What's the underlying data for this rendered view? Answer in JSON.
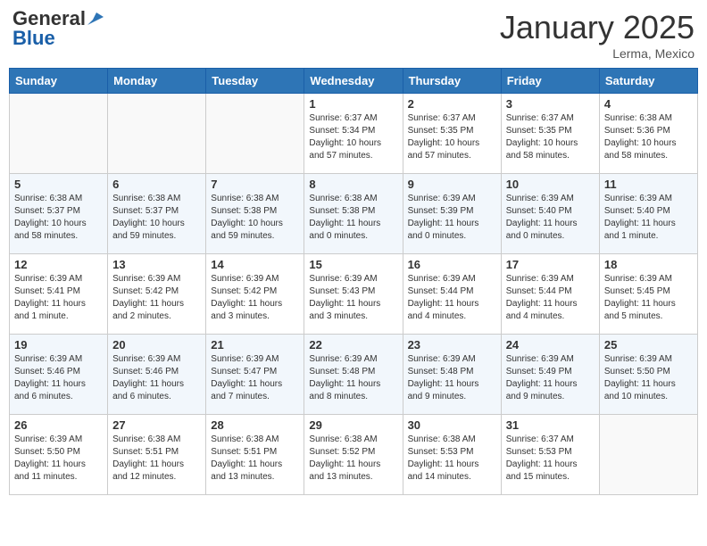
{
  "header": {
    "logo_general": "General",
    "logo_blue": "Blue",
    "month": "January 2025",
    "location": "Lerma, Mexico"
  },
  "days_of_week": [
    "Sunday",
    "Monday",
    "Tuesday",
    "Wednesday",
    "Thursday",
    "Friday",
    "Saturday"
  ],
  "weeks": [
    [
      {
        "day": "",
        "info": ""
      },
      {
        "day": "",
        "info": ""
      },
      {
        "day": "",
        "info": ""
      },
      {
        "day": "1",
        "info": "Sunrise: 6:37 AM\nSunset: 5:34 PM\nDaylight: 10 hours and 57 minutes."
      },
      {
        "day": "2",
        "info": "Sunrise: 6:37 AM\nSunset: 5:35 PM\nDaylight: 10 hours and 57 minutes."
      },
      {
        "day": "3",
        "info": "Sunrise: 6:37 AM\nSunset: 5:35 PM\nDaylight: 10 hours and 58 minutes."
      },
      {
        "day": "4",
        "info": "Sunrise: 6:38 AM\nSunset: 5:36 PM\nDaylight: 10 hours and 58 minutes."
      }
    ],
    [
      {
        "day": "5",
        "info": "Sunrise: 6:38 AM\nSunset: 5:37 PM\nDaylight: 10 hours and 58 minutes."
      },
      {
        "day": "6",
        "info": "Sunrise: 6:38 AM\nSunset: 5:37 PM\nDaylight: 10 hours and 59 minutes."
      },
      {
        "day": "7",
        "info": "Sunrise: 6:38 AM\nSunset: 5:38 PM\nDaylight: 10 hours and 59 minutes."
      },
      {
        "day": "8",
        "info": "Sunrise: 6:38 AM\nSunset: 5:38 PM\nDaylight: 11 hours and 0 minutes."
      },
      {
        "day": "9",
        "info": "Sunrise: 6:39 AM\nSunset: 5:39 PM\nDaylight: 11 hours and 0 minutes."
      },
      {
        "day": "10",
        "info": "Sunrise: 6:39 AM\nSunset: 5:40 PM\nDaylight: 11 hours and 0 minutes."
      },
      {
        "day": "11",
        "info": "Sunrise: 6:39 AM\nSunset: 5:40 PM\nDaylight: 11 hours and 1 minute."
      }
    ],
    [
      {
        "day": "12",
        "info": "Sunrise: 6:39 AM\nSunset: 5:41 PM\nDaylight: 11 hours and 1 minute."
      },
      {
        "day": "13",
        "info": "Sunrise: 6:39 AM\nSunset: 5:42 PM\nDaylight: 11 hours and 2 minutes."
      },
      {
        "day": "14",
        "info": "Sunrise: 6:39 AM\nSunset: 5:42 PM\nDaylight: 11 hours and 3 minutes."
      },
      {
        "day": "15",
        "info": "Sunrise: 6:39 AM\nSunset: 5:43 PM\nDaylight: 11 hours and 3 minutes."
      },
      {
        "day": "16",
        "info": "Sunrise: 6:39 AM\nSunset: 5:44 PM\nDaylight: 11 hours and 4 minutes."
      },
      {
        "day": "17",
        "info": "Sunrise: 6:39 AM\nSunset: 5:44 PM\nDaylight: 11 hours and 4 minutes."
      },
      {
        "day": "18",
        "info": "Sunrise: 6:39 AM\nSunset: 5:45 PM\nDaylight: 11 hours and 5 minutes."
      }
    ],
    [
      {
        "day": "19",
        "info": "Sunrise: 6:39 AM\nSunset: 5:46 PM\nDaylight: 11 hours and 6 minutes."
      },
      {
        "day": "20",
        "info": "Sunrise: 6:39 AM\nSunset: 5:46 PM\nDaylight: 11 hours and 6 minutes."
      },
      {
        "day": "21",
        "info": "Sunrise: 6:39 AM\nSunset: 5:47 PM\nDaylight: 11 hours and 7 minutes."
      },
      {
        "day": "22",
        "info": "Sunrise: 6:39 AM\nSunset: 5:48 PM\nDaylight: 11 hours and 8 minutes."
      },
      {
        "day": "23",
        "info": "Sunrise: 6:39 AM\nSunset: 5:48 PM\nDaylight: 11 hours and 9 minutes."
      },
      {
        "day": "24",
        "info": "Sunrise: 6:39 AM\nSunset: 5:49 PM\nDaylight: 11 hours and 9 minutes."
      },
      {
        "day": "25",
        "info": "Sunrise: 6:39 AM\nSunset: 5:50 PM\nDaylight: 11 hours and 10 minutes."
      }
    ],
    [
      {
        "day": "26",
        "info": "Sunrise: 6:39 AM\nSunset: 5:50 PM\nDaylight: 11 hours and 11 minutes."
      },
      {
        "day": "27",
        "info": "Sunrise: 6:38 AM\nSunset: 5:51 PM\nDaylight: 11 hours and 12 minutes."
      },
      {
        "day": "28",
        "info": "Sunrise: 6:38 AM\nSunset: 5:51 PM\nDaylight: 11 hours and 13 minutes."
      },
      {
        "day": "29",
        "info": "Sunrise: 6:38 AM\nSunset: 5:52 PM\nDaylight: 11 hours and 13 minutes."
      },
      {
        "day": "30",
        "info": "Sunrise: 6:38 AM\nSunset: 5:53 PM\nDaylight: 11 hours and 14 minutes."
      },
      {
        "day": "31",
        "info": "Sunrise: 6:37 AM\nSunset: 5:53 PM\nDaylight: 11 hours and 15 minutes."
      },
      {
        "day": "",
        "info": ""
      }
    ]
  ]
}
